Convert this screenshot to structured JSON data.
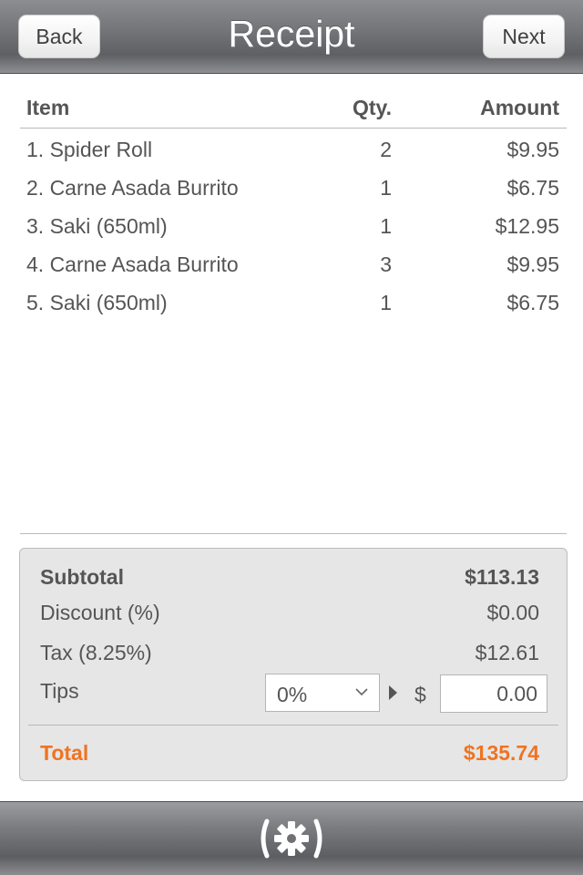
{
  "nav": {
    "title": "Receipt",
    "back_label": "Back",
    "next_label": "Next"
  },
  "table": {
    "headers": {
      "item": "Item",
      "qty": "Qty.",
      "amount": "Amount"
    },
    "rows": [
      {
        "item": "1. Spider Roll",
        "qty": "2",
        "amount": "$9.95"
      },
      {
        "item": "2. Carne Asada Burrito",
        "qty": "1",
        "amount": "$6.75"
      },
      {
        "item": "3. Saki (650ml)",
        "qty": "1",
        "amount": "$12.95"
      },
      {
        "item": "4. Carne Asada Burrito",
        "qty": "3",
        "amount": "$9.95"
      },
      {
        "item": "5. Saki (650ml)",
        "qty": "1",
        "amount": "$6.75"
      }
    ]
  },
  "summary": {
    "subtotal_label": "Subtotal",
    "subtotal_value": "$113.13",
    "discount_label": "Discount (%)",
    "discount_value": "$0.00",
    "tax_label": "Tax (8.25%)",
    "tax_value": "$12.61",
    "tips_label": "Tips",
    "tips_percent": "0%",
    "tips_currency": "$",
    "tips_amount": "0.00",
    "total_label": "Total",
    "total_value": "$135.74"
  },
  "toolbar": {
    "settings_icon": "gear-icon"
  },
  "colors": {
    "accent": "#ef7422",
    "text": "#555555",
    "summary_bg": "#e6e6e6"
  }
}
